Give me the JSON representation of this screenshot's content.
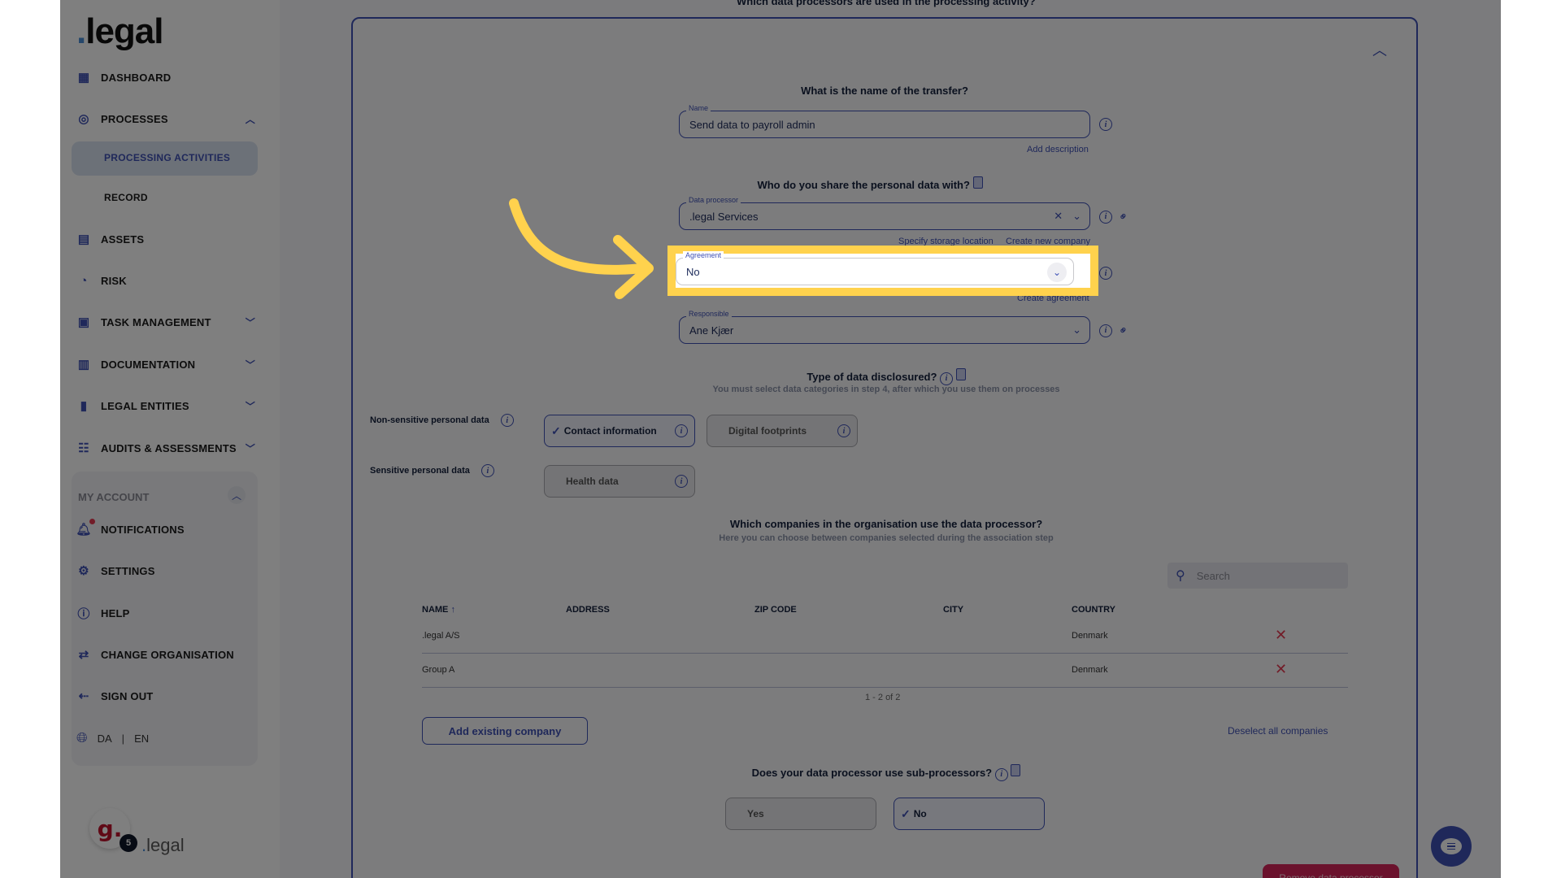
{
  "brand": {
    "logo_dot": ".",
    "logo_text": "legal",
    "accent": "#3f51b5",
    "highlight": "#ffd24d",
    "danger": "#e53950"
  },
  "sidebar": {
    "items": [
      {
        "label": "DASHBOARD",
        "icon": "dashboard-grid-icon"
      },
      {
        "label": "PROCESSES",
        "icon": "processes-icon",
        "expanded": true
      },
      {
        "label": "ASSETS",
        "icon": "assets-icon"
      },
      {
        "label": "RISK",
        "icon": "gauge-icon"
      },
      {
        "label": "TASK MANAGEMENT",
        "icon": "calendar-edit-icon"
      },
      {
        "label": "DOCUMENTATION",
        "icon": "document-upload-icon"
      },
      {
        "label": "LEGAL ENTITIES",
        "icon": "buildings-icon"
      },
      {
        "label": "AUDITS & ASSESSMENTS",
        "icon": "checklist-icon"
      }
    ],
    "sub_items": [
      {
        "label": "PROCESSING ACTIVITIES",
        "active": true
      },
      {
        "label": "RECORD"
      }
    ],
    "account": {
      "title": "MY ACCOUNT",
      "items": [
        {
          "label": "NOTIFICATIONS",
          "icon": "bell-icon"
        },
        {
          "label": "SETTINGS",
          "icon": "gear-icon"
        },
        {
          "label": "HELP",
          "icon": "help-icon"
        },
        {
          "label": "CHANGE ORGANISATION",
          "icon": "swap-icon"
        },
        {
          "label": "SIGN OUT",
          "icon": "sign-out-icon"
        }
      ],
      "lang": {
        "da": "DA",
        "sep": "|",
        "en": "EN"
      }
    },
    "org": {
      "avatar_letter": "g.",
      "badge_count": "5",
      "logo_dot": ".",
      "logo_text": "legal"
    }
  },
  "main": {
    "top_question": "Which data processors are used in the processing activity?",
    "transfer": {
      "question": "What is the name of the transfer?",
      "name_label": "Name",
      "name_value": "Send data to payroll admin",
      "add_description": "Add description"
    },
    "share": {
      "question": "Who do you share the personal data with?",
      "processor_label": "Data processor",
      "processor_value": ".legal Services",
      "specify_storage": "Specify storage location",
      "create_company": "Create new company",
      "agreement_label": "Agreement",
      "agreement_value": "No",
      "create_agreement": "Create agreement",
      "responsible_label": "Responsible",
      "responsible_value": "Ane Kjær"
    },
    "data_type": {
      "question": "Type of data disclosured?",
      "hint": "You must select data categories in step 4, after which you use them on processes",
      "non_sensitive_label": "Non-sensitive personal data",
      "sensitive_label": "Sensitive personal data",
      "non_sensitive_chips": [
        {
          "label": "Contact information",
          "selected": true
        },
        {
          "label": "Digital footprints",
          "selected": false
        }
      ],
      "sensitive_chips": [
        {
          "label": "Health data",
          "selected": false
        }
      ]
    },
    "companies": {
      "question": "Which companies in the organisation use the data processor?",
      "hint": "Here you can choose between companies selected during the association step",
      "search_placeholder": "Search",
      "columns": [
        "NAME",
        "ADDRESS",
        "ZIP CODE",
        "CITY",
        "COUNTRY"
      ],
      "rows": [
        {
          "name": ".legal A/S",
          "address": "",
          "zip": "",
          "city": "",
          "country": "Denmark"
        },
        {
          "name": "Group A",
          "address": "",
          "zip": "",
          "city": "",
          "country": "Denmark"
        }
      ],
      "pager": "1 - 2 of 2",
      "add_existing": "Add existing company",
      "deselect_all": "Deselect all companies"
    },
    "subprocessors": {
      "question": "Does your data processor use sub-processors?",
      "yes": "Yes",
      "no": "No",
      "selected": "No"
    },
    "remove_button": "Remove data processor"
  }
}
